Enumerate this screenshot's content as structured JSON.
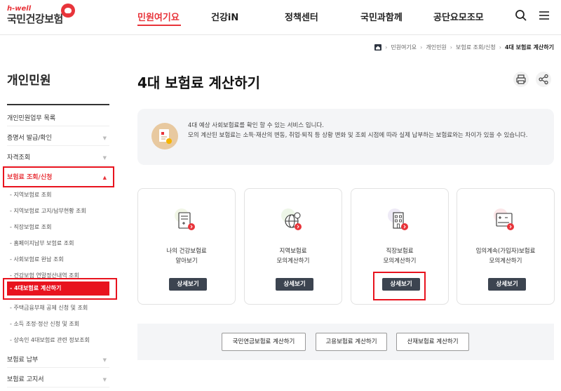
{
  "header": {
    "logo_sub": "h-well",
    "logo_main": "국민건강보험",
    "nav": [
      "민원여기요",
      "건강iN",
      "정책센터",
      "국민과함께",
      "공단요모조모"
    ],
    "brand_color": "#e8343a"
  },
  "breadcrumb": [
    "민원여기요",
    "개인민원",
    "보험료 조회/신청",
    "4대 보험료 계산하기"
  ],
  "sidebar": {
    "title": "개인민원",
    "items_top": [
      "개인민원업무 목록",
      "증명서 발급/확인",
      "자격조회"
    ],
    "open_item": "보험료 조회/신청",
    "sub_items": [
      "지역보험료 조회",
      "지역보험료 고지/납부현황 조회",
      "직장보험료 조회",
      "홈페이지납부 보험료 조회",
      "사회보험료 완납 조회",
      "건강보험 연말정산내역 조회",
      "4대보험료 계산하기",
      "주택금융부채 공제 신청 및 조회",
      "소득 조정·정산 신청 및 조회",
      "상속인 4대보험료 관련 정보조회"
    ],
    "items_bottom": [
      "보험료 납부",
      "보험료 고지서"
    ]
  },
  "main": {
    "title": "4대 보험료 계산하기",
    "info_line1": "4대 예상 사회보험료를 확인 할 수 있는 서비스 입니다.",
    "info_line2": "모의 계산된 보험료는 소득·재산의 변동, 취업·퇴직 등 상황 변화 및 조회 시점에 따라 실제 납부하는 보험료와는 차이가 있을 수 있습니다.",
    "cards": [
      {
        "line1": "나의 건강보험료",
        "line2": "알아보기",
        "button": "상세보기"
      },
      {
        "line1": "지역보험료",
        "line2": "모의계산하기",
        "button": "상세보기"
      },
      {
        "line1": "직장보험료",
        "line2": "모의계산하기",
        "button": "상세보기"
      },
      {
        "line1": "임의계속(가입자)보험료",
        "line2": "모의계산하기",
        "button": "상세보기"
      }
    ],
    "bottom_buttons": [
      "국민연금보험료 계산하기",
      "고용보험료 계산하기",
      "산재보험료 계산하기"
    ]
  }
}
